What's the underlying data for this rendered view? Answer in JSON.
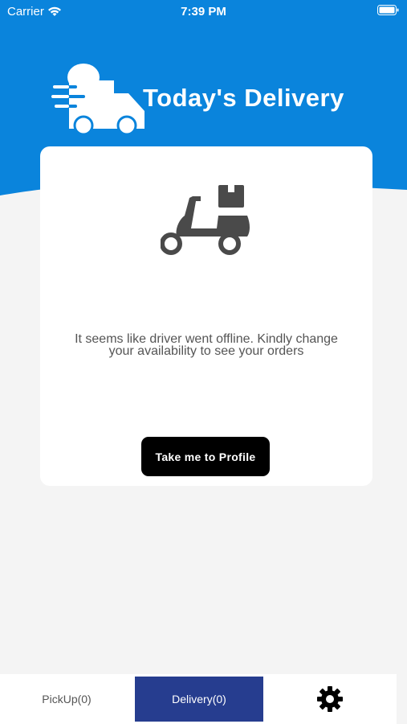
{
  "status_bar": {
    "carrier": "Carrier",
    "time": "7:39 PM"
  },
  "header": {
    "title": "Today's Delivery",
    "icon": "delivery-truck-icon",
    "color": "#0a84dc"
  },
  "card": {
    "icon": "scooter-delivery-icon",
    "message": "It seems like driver went offline. Kindly change your availability to see your orders",
    "button_label": "Take me to Profile"
  },
  "tab_bar": {
    "tabs": [
      {
        "label": "PickUp(0)",
        "active": false
      },
      {
        "label": "Delivery(0)",
        "active": true
      },
      {
        "label": "",
        "icon": "gear-icon"
      }
    ],
    "active_color": "#263d8f"
  }
}
